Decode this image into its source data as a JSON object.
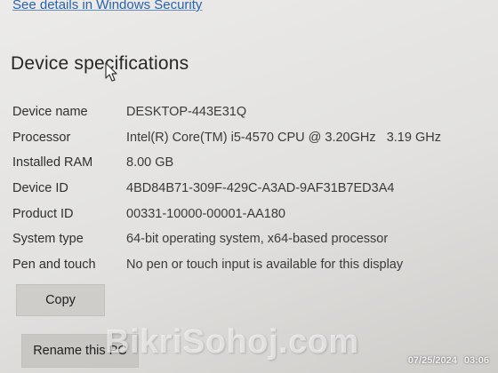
{
  "security_link": "See details in Windows Security",
  "section": {
    "title": "Device specifications"
  },
  "specs": [
    {
      "label": "Device name",
      "value": "DESKTOP-443E31Q"
    },
    {
      "label": "Processor",
      "value": "Intel(R) Core(TM) i5-4570 CPU @ 3.20GHz   3.19 GHz"
    },
    {
      "label": "Installed RAM",
      "value": "8.00 GB"
    },
    {
      "label": "Device ID",
      "value": "4BD84B71-309F-429C-A3AD-9AF31B7ED3A4"
    },
    {
      "label": "Product ID",
      "value": "00331-10000-00001-AA180"
    },
    {
      "label": "System type",
      "value": "64-bit operating system, x64-based processor"
    },
    {
      "label": "Pen and touch",
      "value": "No pen or touch input is available for this display"
    }
  ],
  "buttons": {
    "copy": "Copy",
    "rename": "Rename this PC"
  },
  "watermark": "BikriSohoj.com",
  "photo_stamp": {
    "date": "07/25/2024",
    "time": "03:06"
  },
  "icons": {
    "cursor": "mouse-pointer-icon"
  }
}
